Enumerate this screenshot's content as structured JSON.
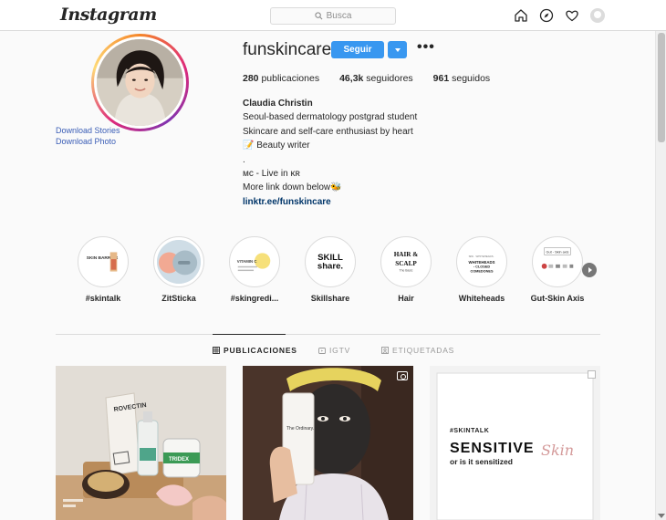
{
  "nav": {
    "logo": "Instagram",
    "search_placeholder": "Busca"
  },
  "profile": {
    "username": "funskincare",
    "follow_label": "Seguir",
    "download_stories": "Download Stories",
    "download_photo": "Download Photo",
    "stats": {
      "posts_count": "280",
      "posts_label": "publicaciones",
      "followers_count": "46,3k",
      "followers_label": "seguidores",
      "following_count": "961",
      "following_label": "seguidos"
    },
    "bio": {
      "name": "Claudia Christin",
      "line1": "Seoul-based dermatology postgrad student",
      "line2": "Skincare and self-care enthusiast by heart",
      "line3": "📝 Beauty writer",
      "line4": ".",
      "line5": "ᴍᴄ - Live in ᴋʀ",
      "line6": "More link down below🐝",
      "link": "linktr.ee/funskincare"
    }
  },
  "highlights": [
    {
      "label": "#skintalk",
      "cover": "SKIN BARRIER"
    },
    {
      "label": "ZitSticka",
      "cover": ""
    },
    {
      "label": "#skingredi...",
      "cover": "VITAMIN C"
    },
    {
      "label": "Skillshare",
      "cover": "SKILL share."
    },
    {
      "label": "Hair",
      "cover": "HAIR & SCALP"
    },
    {
      "label": "Whiteheads",
      "cover": "WHITEHEADS · CLOSED COMEDONES"
    },
    {
      "label": "Gut-Skin Axis",
      "cover": "Gut - Skin axis"
    }
  ],
  "tabs": [
    {
      "label": "PUBLICACIONES",
      "active": true,
      "icon": "grid-icon"
    },
    {
      "label": "IGTV",
      "active": false,
      "icon": "igtv-icon"
    },
    {
      "label": "ETIQUETADAS",
      "active": false,
      "icon": "tag-icon"
    }
  ],
  "posts": [
    {
      "caption_main": "ROVECTIN",
      "caption_sub": "TRIDEX"
    },
    {
      "caption_main": "The Ordinary."
    },
    {
      "tag": "#SKINTALK",
      "headline": "SENSITIVE",
      "script": "Skin",
      "subline": "or is it sensitized"
    }
  ]
}
